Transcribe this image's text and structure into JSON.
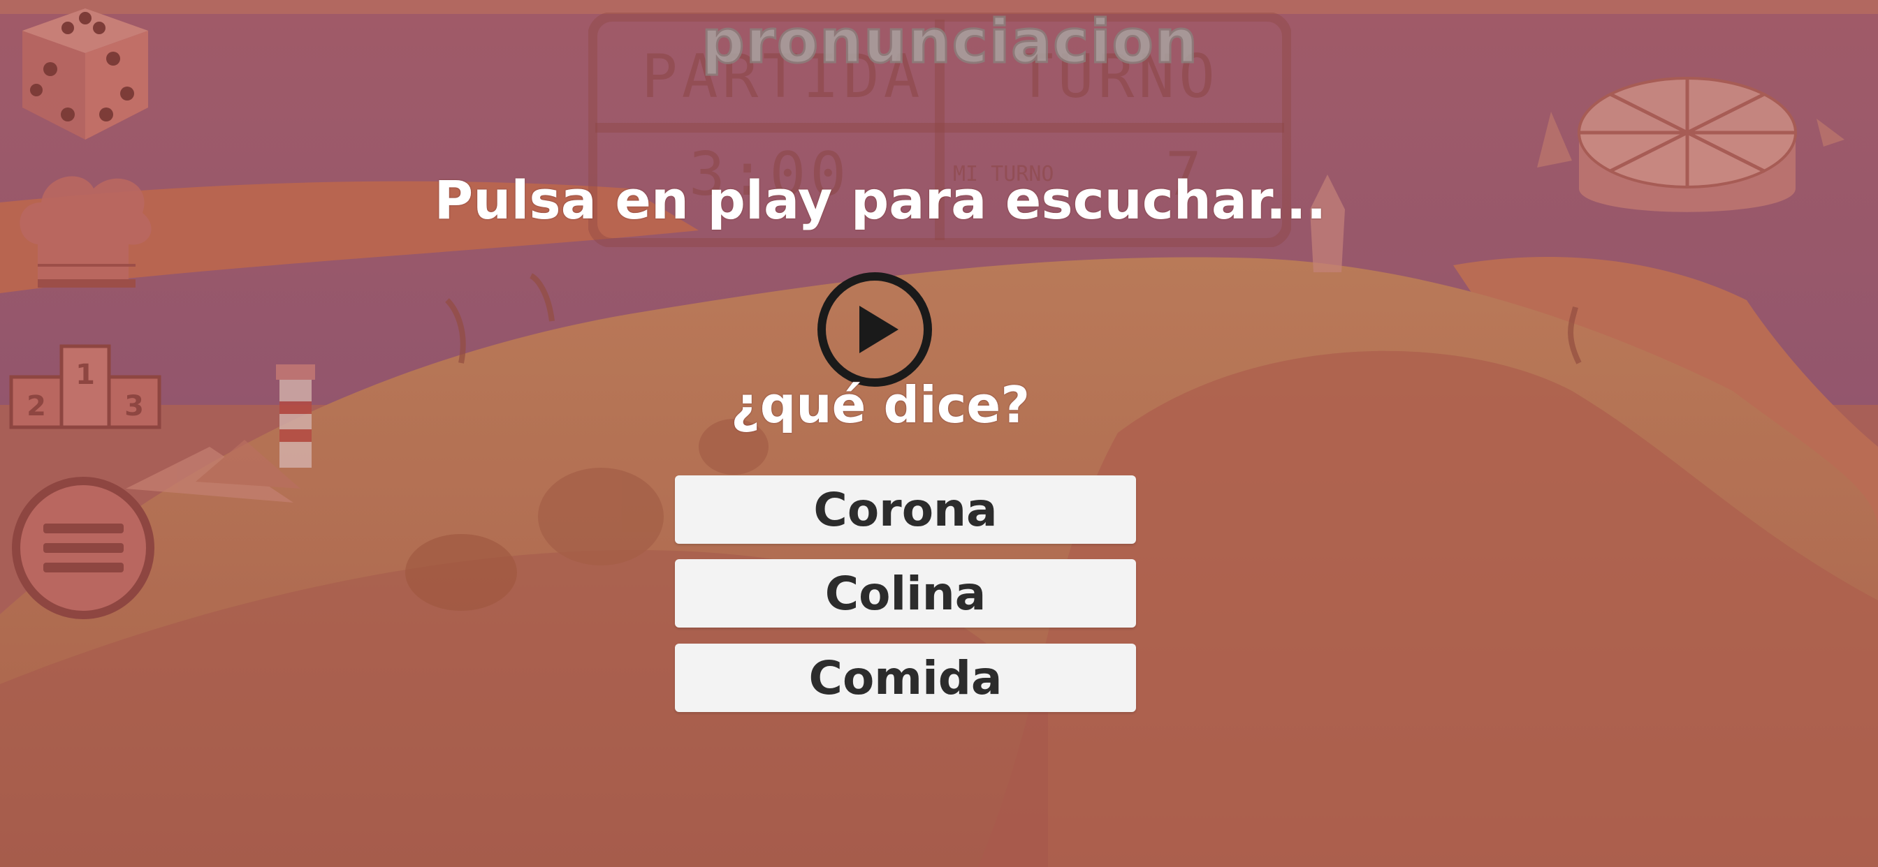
{
  "scoreboard": {
    "title": "pronunciacion",
    "col_left_header": "PARTIDA",
    "col_right_header": "TURNO",
    "left_value": "3:00",
    "right_caption": "MI TURNO",
    "right_value": "7"
  },
  "podium": {
    "second": "2",
    "first": "1",
    "third": "3"
  },
  "quiz": {
    "instruction": "Pulsa en play para escuchar...",
    "question": "¿qué dice?",
    "options": [
      {
        "label": "Corona"
      },
      {
        "label": "Colina"
      },
      {
        "label": "Comida"
      }
    ]
  },
  "icons": {
    "dice": "dice-icon",
    "chef": "chef-hat-icon",
    "ranking": "podium-icon",
    "menu": "hamburger-menu-icon",
    "play": "play-icon",
    "wheel": "category-wheel-icon"
  },
  "colors": {
    "overlay": "#a4645d",
    "option_bg": "#f3f3f3",
    "option_text": "#2c2c2c",
    "text_light": "#ffffff"
  }
}
